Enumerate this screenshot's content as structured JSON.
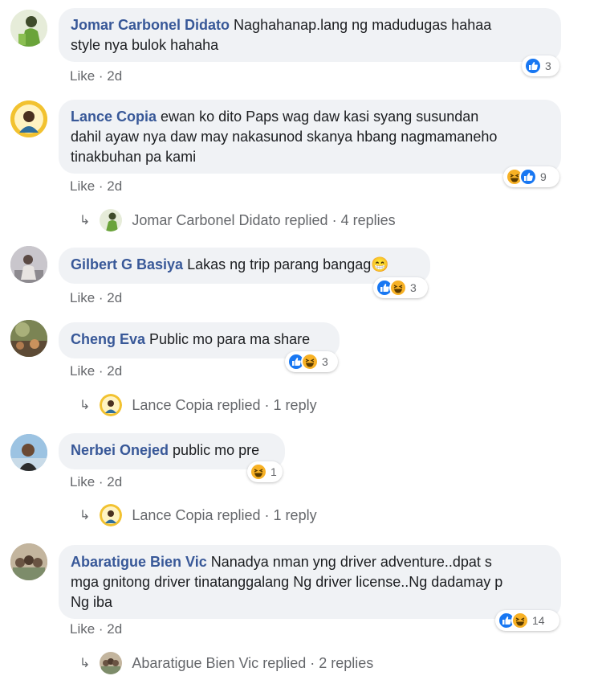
{
  "comments": [
    {
      "author": "Jomar Carbonel Didato",
      "text_lines": [
        "Naghahanap.lang ng madudugas hahaa",
        "style nya bulok hahaha"
      ],
      "like_label": "Like",
      "time": "2d",
      "reactions": [
        "like"
      ],
      "reaction_count": "3"
    },
    {
      "author": "Lance Copia",
      "text_lines": [
        "ewan ko dito Paps wag daw kasi syang susundan",
        "dahil ayaw nya daw may nakasunod skanya hbang nagmamaneho",
        "tinakbuhan pa kami"
      ],
      "like_label": "Like",
      "time": "2d",
      "reactions": [
        "haha",
        "like"
      ],
      "reaction_count": "9",
      "replies": {
        "author": "Jomar Carbonel Didato",
        "replied_label": "replied",
        "count": "4 replies"
      }
    },
    {
      "author": "Gilbert G Basiya",
      "text_lines": [
        "Lakas ng trip parang bangag😁"
      ],
      "like_label": "Like",
      "time": "2d",
      "reactions": [
        "like",
        "haha"
      ],
      "reaction_count": "3"
    },
    {
      "author": "Cheng Eva",
      "text_lines": [
        "Public mo para ma share"
      ],
      "like_label": "Like",
      "time": "2d",
      "reactions": [
        "like",
        "haha"
      ],
      "reaction_count": "3",
      "replies": {
        "author": "Lance Copia",
        "replied_label": "replied",
        "count": "1 reply"
      }
    },
    {
      "author": "Nerbei Onejed",
      "text_lines": [
        "public mo pre"
      ],
      "like_label": "Like",
      "time": "2d",
      "reactions": [
        "haha"
      ],
      "reaction_count": "1",
      "replies": {
        "author": "Lance Copia",
        "replied_label": "replied",
        "count": "1 reply"
      }
    },
    {
      "author": "Abaratigue Bien Vic",
      "text_lines": [
        "Nanadya nman yng driver adventure..dpat s",
        "mga gnitong driver tinatanggalang Ng driver license..Ng dadamay p",
        "Ng iba"
      ],
      "like_label": "Like",
      "time": "2d",
      "reactions": [
        "like",
        "haha"
      ],
      "reaction_count": "14",
      "replies": {
        "author": "Abaratigue Bien Vic",
        "replied_label": "replied",
        "count": "2 replies"
      }
    }
  ],
  "colors": {
    "author_link": "#385898",
    "bubble_bg": "#f0f2f5",
    "meta_text": "#65676b",
    "like_blue": "#1877f2",
    "haha_yellow": "#f7b125"
  }
}
